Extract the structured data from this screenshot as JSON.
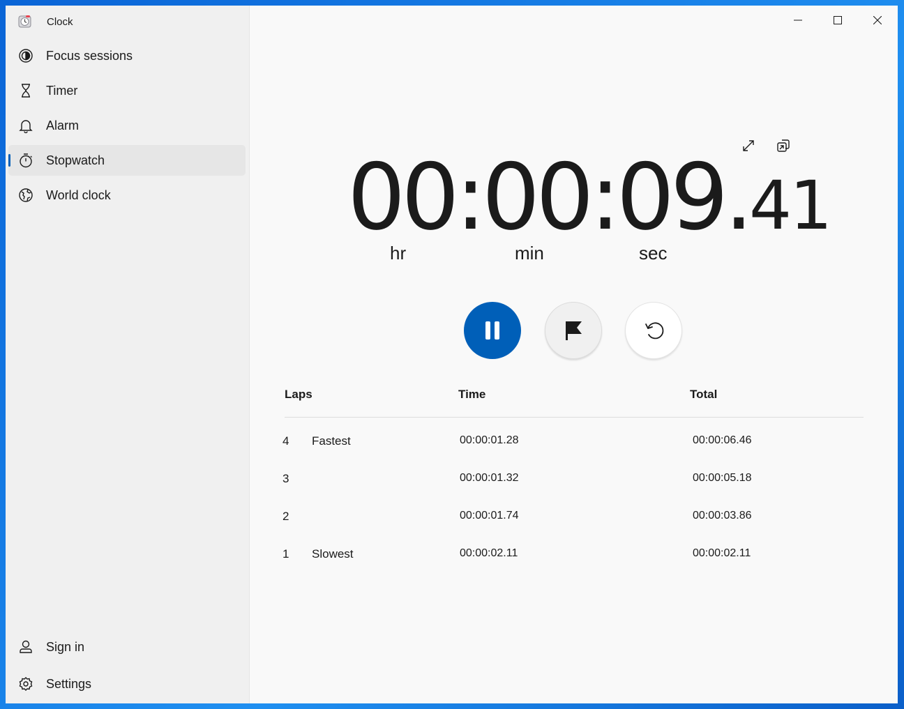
{
  "app": {
    "title": "Clock"
  },
  "sidebar": {
    "items": [
      {
        "label": "Focus sessions",
        "icon": "focus-icon"
      },
      {
        "label": "Timer",
        "icon": "hourglass-icon"
      },
      {
        "label": "Alarm",
        "icon": "bell-icon"
      },
      {
        "label": "Stopwatch",
        "icon": "stopwatch-icon",
        "selected": true
      },
      {
        "label": "World clock",
        "icon": "globe-icon"
      }
    ],
    "footer": [
      {
        "label": "Sign in",
        "icon": "person-icon"
      },
      {
        "label": "Settings",
        "icon": "gear-icon"
      }
    ]
  },
  "stopwatch": {
    "hours": "00",
    "sep1": ":",
    "minutes": "00",
    "sep2": ":",
    "seconds": "09",
    "dot": ".",
    "hundredths": "41",
    "units": {
      "hr": "hr",
      "min": "min",
      "sec": "sec"
    }
  },
  "laps": {
    "headers": {
      "laps": "Laps",
      "time": "Time",
      "total": "Total"
    },
    "rows": [
      {
        "num": "4",
        "tag": "Fastest",
        "time": "00:00:01.28",
        "total": "00:00:06.46"
      },
      {
        "num": "3",
        "tag": "",
        "time": "00:00:01.32",
        "total": "00:00:05.18"
      },
      {
        "num": "2",
        "tag": "",
        "time": "00:00:01.74",
        "total": "00:00:03.86"
      },
      {
        "num": "1",
        "tag": "Slowest",
        "time": "00:00:02.11",
        "total": "00:00:02.11"
      }
    ]
  },
  "colors": {
    "accent": "#005fb8",
    "sidebar_bg": "#f0f0f0",
    "content_bg": "#f9f9f9"
  }
}
